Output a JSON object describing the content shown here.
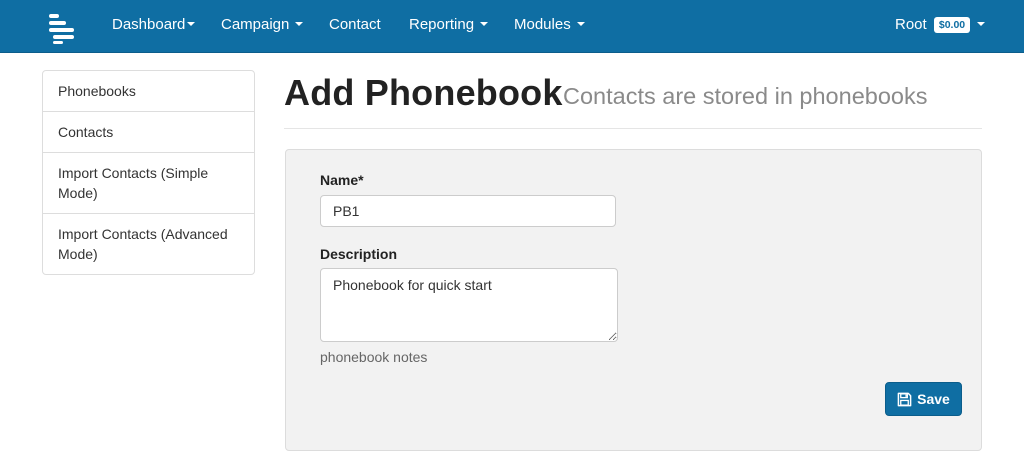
{
  "navbar": {
    "brand_icon": "logo-icon",
    "items": [
      {
        "label": "Dashboard",
        "dropdown": true
      },
      {
        "label": "Campaign",
        "dropdown": true
      },
      {
        "label": "Contact",
        "dropdown": false
      },
      {
        "label": "Reporting",
        "dropdown": true
      },
      {
        "label": "Modules",
        "dropdown": true
      }
    ],
    "user": {
      "label": "Root",
      "balance": "$0.00"
    },
    "color": "#0f6ea3"
  },
  "sidebar": {
    "items": [
      {
        "label": "Phonebooks"
      },
      {
        "label": "Contacts"
      },
      {
        "label": "Import Contacts (Simple Mode)"
      },
      {
        "label": "Import Contacts (Advanced Mode)"
      }
    ]
  },
  "page": {
    "title": "Add Phonebook",
    "subtitle": "Contacts are stored in phonebooks"
  },
  "form": {
    "name_label": "Name*",
    "name_value": "PB1",
    "description_label": "Description",
    "description_value": "Phonebook for quick start",
    "description_help": "phonebook notes",
    "save_label": "Save",
    "save_icon": "floppy-disk-icon"
  }
}
